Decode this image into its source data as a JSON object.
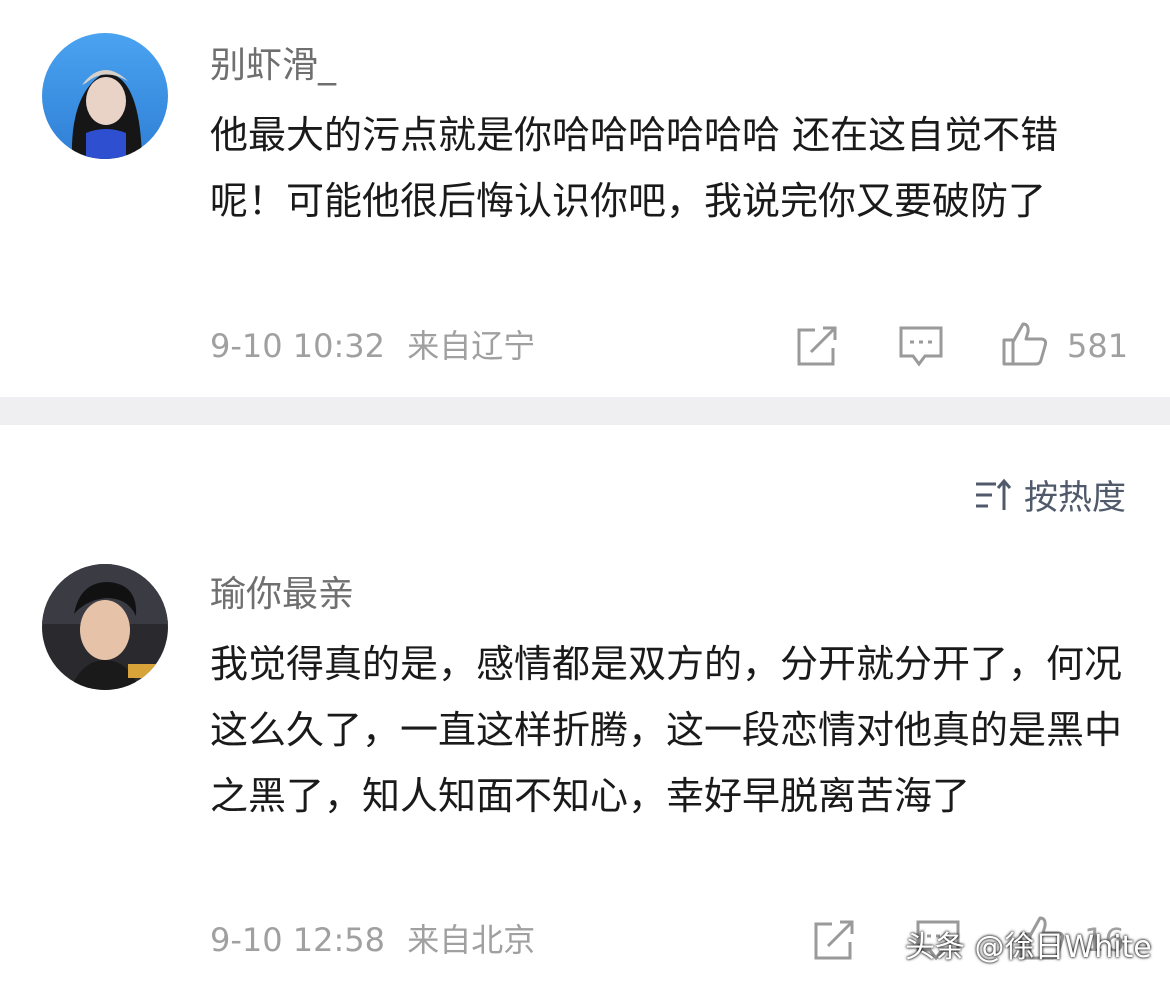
{
  "comments": [
    {
      "username": "别虾滑_",
      "text": "他最大的污点就是你哈哈哈哈哈哈 还在这自觉不错呢！可能他很后悔认识你吧，我说完你又要破防了",
      "date": "9-10 10:32",
      "location": "来自辽宁",
      "likes": "581"
    },
    {
      "username": "瑜你最亲",
      "text": "我觉得真的是，感情都是双方的，分开就分开了，何况这么久了，一直这样折腾，这一段恋情对他真的是黑中之黑了，知人知面不知心，幸好早脱离苦海了",
      "date": "9-10 12:58",
      "location": "来自北京",
      "likes": "16"
    }
  ],
  "sort": {
    "label": "按热度"
  },
  "watermark": "头条 @徐日White",
  "icons": {
    "share": "share-icon",
    "comment": "comment-icon",
    "like": "thumbs-up-icon",
    "sort": "sort-icon"
  },
  "colors": {
    "username": "#6f6f6f",
    "meta": "#a0a0a0",
    "divider": "#efeff1",
    "sort": "#505a6b"
  }
}
